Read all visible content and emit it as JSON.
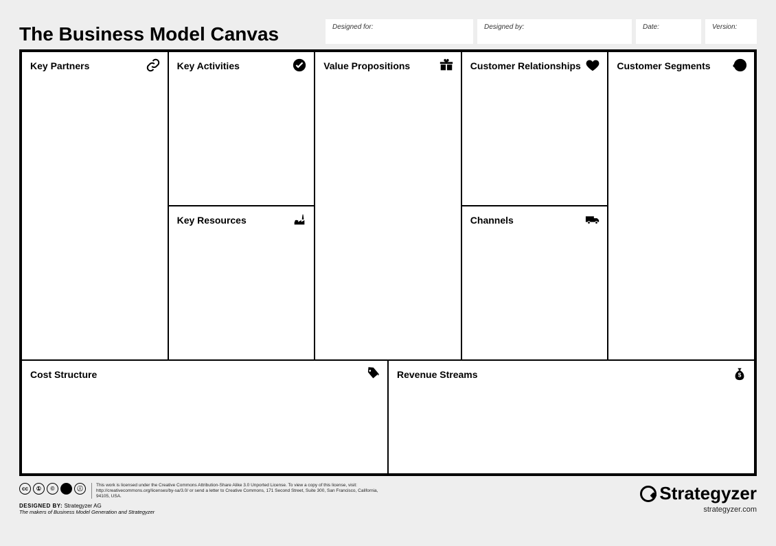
{
  "title": "The Business Model Canvas",
  "meta": {
    "designed_for": "Designed for:",
    "designed_by": "Designed by:",
    "date": "Date:",
    "version": "Version:"
  },
  "blocks": {
    "kp": "Key Partners",
    "ka": "Key Activities",
    "kr": "Key Resources",
    "vp": "Value Propositions",
    "cr": "Customer Relationships",
    "ch": "Channels",
    "cs": "Customer Segments",
    "cost": "Cost Structure",
    "rev": "Revenue Streams"
  },
  "footer": {
    "license_line1": "This work is licensed under the Creative Commons Attribution-Share Alike 3.0 Unported License. To view a copy of this license, visit:",
    "license_line2": "http://creativecommons.org/licenses/by-sa/3.0/ or send a letter to Creative Commons, 171 Second Street, Suite 300, San Francisco, California, 94105, USA.",
    "designed_by_label": "DESIGNED BY:",
    "designed_by_value": "Strategyzer AG",
    "tagline": "The makers of Business Model Generation and Strategyzer",
    "logo": "Strategyzer",
    "site": "strategyzer.com",
    "cc_badges": [
      "cc",
      "①",
      "©",
      "☻",
      "ⓘ"
    ]
  }
}
